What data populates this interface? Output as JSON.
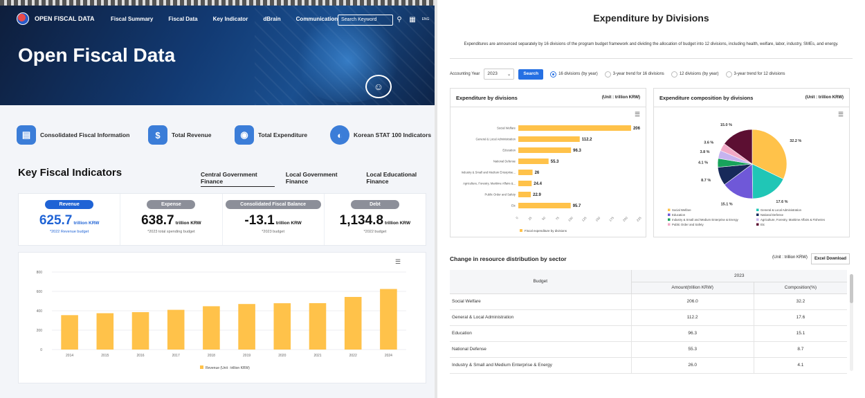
{
  "left": {
    "header": {
      "logo_text": "OPEN FISCAL DATA",
      "nav": [
        "Fiscal Summary",
        "Fiscal Data",
        "Key Indicator",
        "dBrain",
        "Communication"
      ],
      "search_placeholder": "Search Keyword",
      "lang": "ENG",
      "hero_title": "Open Fiscal Data"
    },
    "quick_links": [
      {
        "label": "Consolidated Fiscal Information",
        "icon": "document-coins-icon"
      },
      {
        "label": "Total Revenue",
        "icon": "money-stack-icon"
      },
      {
        "label": "Total Expenditure",
        "icon": "money-bag-icon"
      },
      {
        "label": "Korean STAT 100 Indicators",
        "icon": "gauge-icon"
      }
    ],
    "kfi": {
      "title": "Key Fiscal Indicators",
      "tabs": [
        "Central Government Finance",
        "Local Government Finance",
        "Local Educational Finance"
      ],
      "cards": [
        {
          "pill": "Revenue",
          "value": "625.7",
          "unit": "trillion KRW",
          "note": "*2022 Revenue budget"
        },
        {
          "pill": "Expense",
          "value": "638.7",
          "unit": "trillion KRW",
          "note": "*2023 total spending budget"
        },
        {
          "pill": "Consolidated Fiscal Balance",
          "value": "-13.1",
          "unit": "trillion KRW",
          "note": "*2023 budget"
        },
        {
          "pill": "Debt",
          "value": "1,134.8",
          "unit": "trillion KRW",
          "note": "*2022 budget"
        }
      ]
    }
  },
  "right": {
    "title": "Expenditure by Divisions",
    "description": "Expenditures are announced separately by 16 divisions of the program budget framework and dividing the allocation of budget into 12 divisions, including health, welfare, labor, industry, SMEs, and energy.",
    "filter": {
      "label": "Accounting Year",
      "year": "2023",
      "search_btn": "Search",
      "options": [
        "16 divisions (by year)",
        "3-year trend for 16 divisions",
        "12 divisions (by year)",
        "3-year trend for 12 divisions"
      ]
    },
    "bar_panel": {
      "title": "Expenditure by divisions",
      "unit": "(Unit : trillion KRW)"
    },
    "pie_panel": {
      "title": "Expenditure composition by divisions",
      "unit": "(Unit : trillion KRW)"
    },
    "table": {
      "title": "Change in resource distribution by sector",
      "unit": "(Unit : trillion KRW)",
      "excel_btn": "Excel Download",
      "year": "2023",
      "col_budget": "Budget",
      "col_amount": "Amount(trillion KRW)",
      "col_comp": "Composition(%)",
      "rows": [
        [
          "Social Welfare",
          "206.0",
          "32.2"
        ],
        [
          "General & Local Administration",
          "112.2",
          "17.6"
        ],
        [
          "Education",
          "96.3",
          "15.1"
        ],
        [
          "National Defense",
          "55.3",
          "8.7"
        ],
        [
          "Industry & Small and Medium Enterprise & Energy",
          "26.0",
          "4.1"
        ]
      ]
    }
  },
  "chart_data": [
    {
      "type": "bar",
      "categories": [
        "2014",
        "2015",
        "2016",
        "2017",
        "2018",
        "2019",
        "2020",
        "2021",
        "2022",
        "2024"
      ],
      "values": [
        355,
        375,
        386,
        410,
        447,
        470,
        478,
        479,
        543,
        625
      ],
      "ylim": [
        0,
        800
      ],
      "yticks": [
        0,
        200,
        400,
        600,
        800
      ],
      "legend": "Revenue (Unit : trillion KRW)",
      "color": "#ffc24a"
    },
    {
      "type": "bar",
      "orientation": "horizontal",
      "categories": [
        "Social Welfare",
        "General & Local Administration",
        "Education",
        "National Defense",
        "Industry & Small and Medium Enterprise...",
        "Agriculture, Forestry, Maritime Affairs &...",
        "Public Order and Safety",
        "Etc"
      ],
      "values": [
        206,
        112.2,
        96.3,
        55.3,
        26,
        24.4,
        22.9,
        95.7
      ],
      "xlim": [
        0,
        225
      ],
      "xticks": [
        0,
        25,
        50,
        75,
        100,
        125,
        150,
        175,
        200,
        225
      ],
      "legend": "Fiscal expenditure by divisions",
      "color": "#ffc24a"
    },
    {
      "type": "pie",
      "labels": [
        "Social Welfare",
        "General & Local Administration",
        "Education",
        "National Defense",
        "Industry & Small and Medium Enterprise & Energy",
        "Agriculture, Forestry, Maritime Affairs & Fisheries",
        "Public Order and Safety",
        "Etc"
      ],
      "values": [
        32.2,
        17.6,
        15.1,
        8.7,
        4.1,
        3.8,
        3.6,
        15.0
      ],
      "colors": [
        "#ffc24a",
        "#20c6b6",
        "#6f58d8",
        "#17295a",
        "#18a35c",
        "#c6b3ef",
        "#f2a9c6",
        "#5c0f32"
      ]
    }
  ]
}
